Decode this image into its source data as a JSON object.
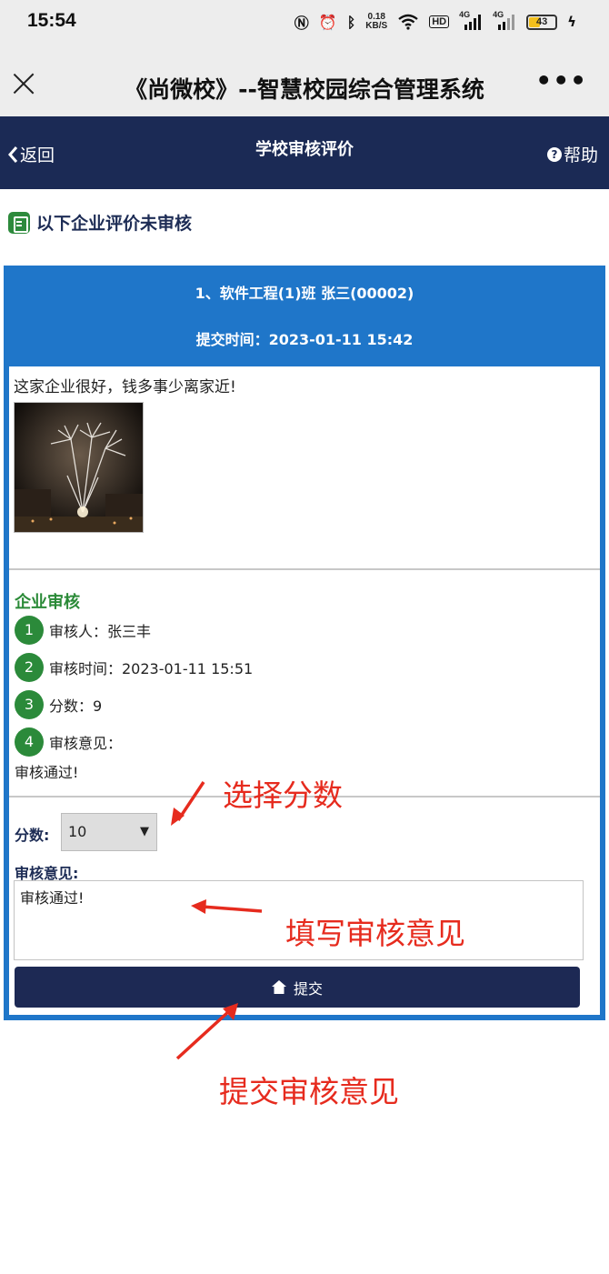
{
  "status_bar": {
    "time": "15:54",
    "net_speed_value": "0.18",
    "net_speed_unit": "KB/S",
    "hd_label": "HD",
    "signal1_label": "4G",
    "signal2_label": "4G",
    "battery": "43"
  },
  "title_bar": {
    "title": "《尚微校》--智慧校园综合管理系统",
    "more": "•••"
  },
  "nav": {
    "back": "返回",
    "title": "学校审核评价",
    "help": "帮助"
  },
  "section": {
    "heading": "以下企业评价未审核"
  },
  "record": {
    "header": "1、软件工程(1)班  张三(00002)",
    "submit_time": "提交时间：2023-01-11 15:42",
    "evaluation_text": "这家企业很好，钱多事少离家近!"
  },
  "company_review": {
    "title": "企业审核",
    "items": [
      {
        "num": "1",
        "text": "审核人：张三丰"
      },
      {
        "num": "2",
        "text": "审核时间：2023-01-11 15:51"
      },
      {
        "num": "3",
        "text": "分数：9"
      },
      {
        "num": "4",
        "text": "审核意见："
      }
    ],
    "opinion": "审核通过!"
  },
  "form": {
    "score_label": "分数:",
    "score_value": "10",
    "opinion_label": "审核意见:",
    "opinion_value": "审核通过!",
    "submit_label": "提交"
  },
  "annotations": {
    "select_score": "选择分数",
    "fill_opinion": "填写审核意见",
    "submit_opinion": "提交审核意见"
  },
  "colors": {
    "nav_bg": "#1b2a55",
    "card_blue": "#1f76c9",
    "badge_green": "#2b8a3a",
    "annotation_red": "#e62b1e"
  }
}
